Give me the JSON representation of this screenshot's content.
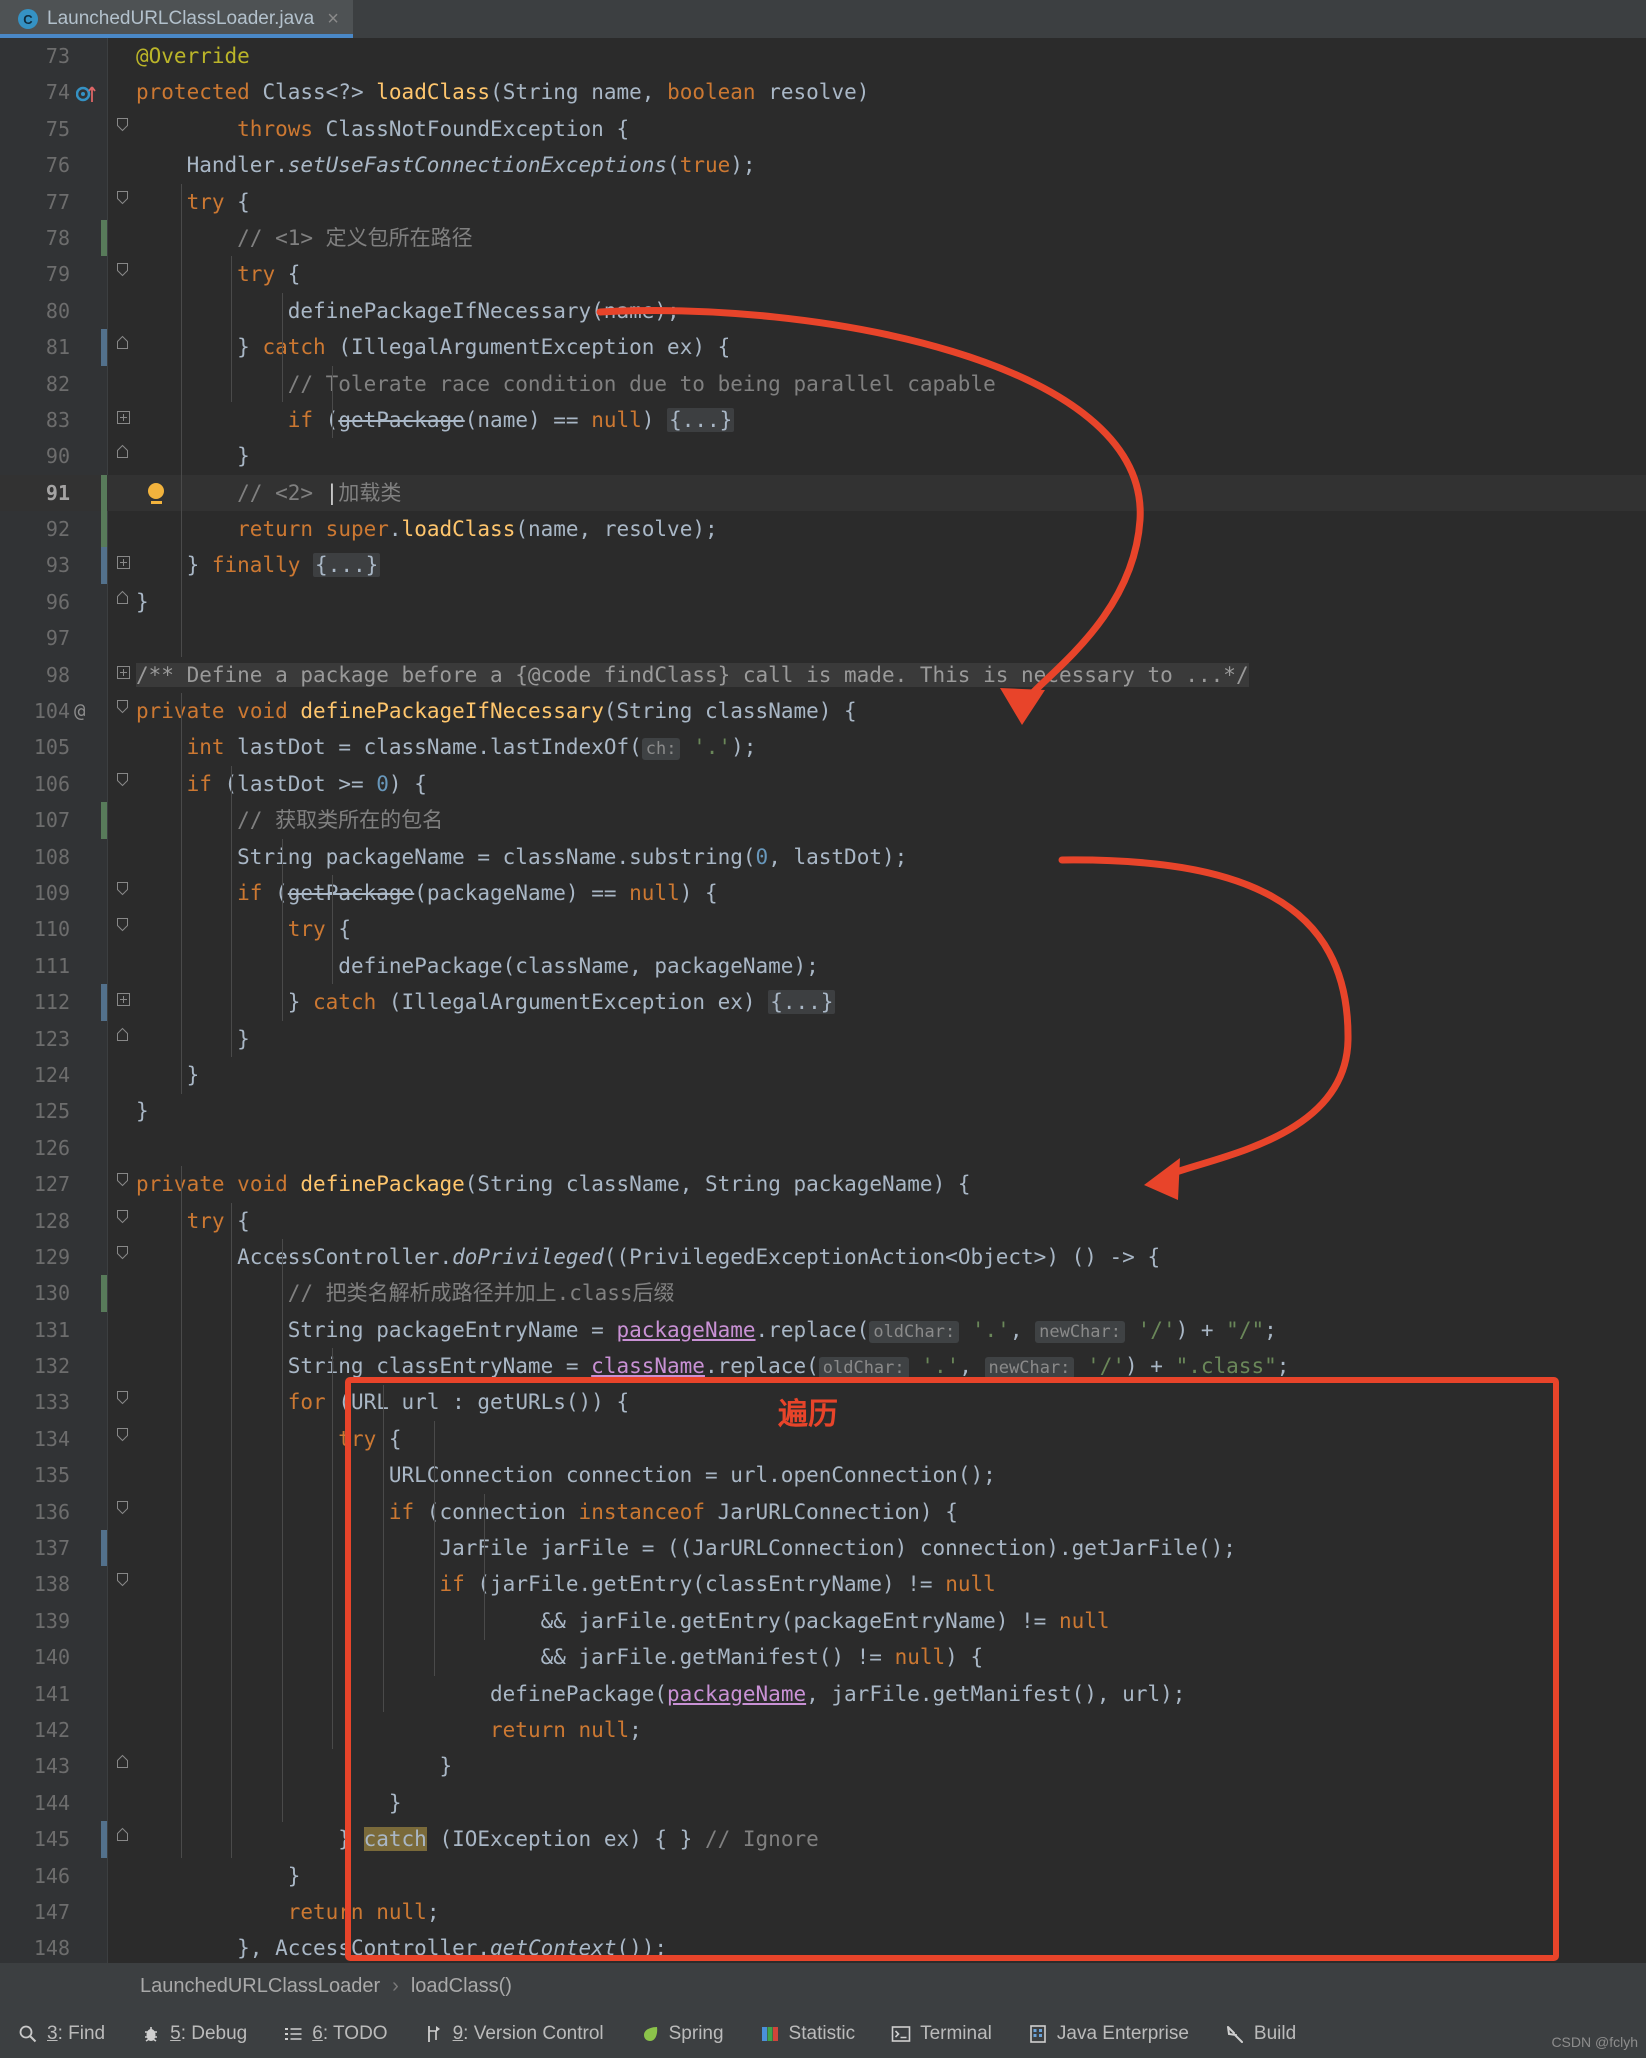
{
  "tab": {
    "icon": "java-class-icon",
    "title": "LaunchedURLClassLoader.java",
    "close": "×"
  },
  "editor": {
    "lines": [
      {
        "num": "73",
        "indent": 0,
        "html": "<span class=\"ann\">@Override</span>"
      },
      {
        "num": "74",
        "indent": 0,
        "html": "<span class=\"kw\">protected</span> <span class=\"txt\">Class&lt;?&gt;</span> <span class=\"mth\">loadClass</span><span class=\"txt\">(String name, </span><span class=\"kw\">boolean</span><span class=\"txt\"> resolve)</span>"
      },
      {
        "num": "75",
        "indent": 0,
        "html": "        <span class=\"kw\">throws</span> <span class=\"txt\">ClassNotFoundException {</span>"
      },
      {
        "num": "76",
        "indent": 0,
        "html": "    <span class=\"txt\">Handler.</span><span class=\"txt ital\">setUseFastConnectionExceptions</span><span class=\"txt\">(</span><span class=\"kw\">true</span><span class=\"txt\">);</span>"
      },
      {
        "num": "77",
        "indent": 0,
        "html": "    <span class=\"kw\">try</span> <span class=\"txt\">{</span>"
      },
      {
        "num": "78",
        "indent": 0,
        "html": "        <span class=\"cmt\">// &lt;1&gt; 定义包所在路径</span>"
      },
      {
        "num": "79",
        "indent": 0,
        "html": "        <span class=\"kw\">try</span> <span class=\"txt\">{</span>"
      },
      {
        "num": "80",
        "indent": 0,
        "html": "            <span class=\"txt\">definePackageIfNecessary(name);</span>"
      },
      {
        "num": "81",
        "indent": 0,
        "html": "        <span class=\"txt\">} </span><span class=\"kw\">catch</span> <span class=\"txt\">(IllegalArgumentException ex) {</span>"
      },
      {
        "num": "82",
        "indent": 0,
        "html": "            <span class=\"cmt\">// Tolerate race condition due to being parallel capable</span>"
      },
      {
        "num": "83",
        "indent": 0,
        "html": "            <span class=\"kw\">if</span> <span class=\"txt\">(</span><span class=\"txt strike\">getPackage</span><span class=\"txt\">(name) == </span><span class=\"kw\">null</span><span class=\"txt\">) </span><span class=\"fold\">{...}</span>"
      },
      {
        "num": "90",
        "indent": 0,
        "html": "        <span class=\"txt\">}</span>"
      },
      {
        "num": "91",
        "indent": 0,
        "current": true,
        "html": "        <span class=\"cmt\">// &lt;2&gt; </span><span class=\"caret\">|</span><span class=\"cmt\">加载类</span>"
      },
      {
        "num": "92",
        "indent": 0,
        "html": "        <span class=\"kw\">return</span> <span class=\"kw\">super</span><span class=\"txt\">.</span><span class=\"mth\">loadClass</span><span class=\"txt\">(name, resolve);</span>"
      },
      {
        "num": "93",
        "indent": 0,
        "html": "    <span class=\"txt\">} </span><span class=\"kw\">finally</span> <span class=\"fold\">{...}</span>"
      },
      {
        "num": "96",
        "indent": 0,
        "html": "<span class=\"txt\">}</span>"
      },
      {
        "num": "97",
        "indent": 0,
        "html": ""
      },
      {
        "num": "98",
        "indent": 0,
        "html": "<span class=\"doc docbg\">/** Define a package before a {@code findClass} call is made. This is necessary to ...*/</span>"
      },
      {
        "num": "104",
        "indent": 0,
        "html": "<span class=\"kw\">private</span> <span class=\"kw\">void</span> <span class=\"mth\">definePackageIfNecessary</span><span class=\"txt\">(String className) {</span>"
      },
      {
        "num": "105",
        "indent": 0,
        "html": "    <span class=\"kw\">int</span> <span class=\"txt\">lastDot = className.lastIndexOf(</span><span class=\"hint\">ch:</span> <span class=\"str\">'.'</span><span class=\"txt\">);</span>"
      },
      {
        "num": "106",
        "indent": 0,
        "html": "    <span class=\"kw\">if</span> <span class=\"txt\">(lastDot &gt;= </span><span class=\"num0\">0</span><span class=\"txt\">) {</span>"
      },
      {
        "num": "107",
        "indent": 0,
        "html": "        <span class=\"cmt\">// 获取类所在的包名</span>"
      },
      {
        "num": "108",
        "indent": 0,
        "html": "        <span class=\"txt\">String packageName = className.substring(</span><span class=\"num0\">0</span><span class=\"txt\">, lastDot);</span>"
      },
      {
        "num": "109",
        "indent": 0,
        "html": "        <span class=\"kw\">if</span> <span class=\"txt\">(</span><span class=\"txt strike\">getPackage</span><span class=\"txt\">(packageName) == </span><span class=\"kw\">null</span><span class=\"txt\">) {</span>"
      },
      {
        "num": "110",
        "indent": 0,
        "html": "            <span class=\"kw\">try</span> <span class=\"txt\">{</span>"
      },
      {
        "num": "111",
        "indent": 0,
        "html": "                <span class=\"txt\">definePackage(className, packageName);</span>"
      },
      {
        "num": "112",
        "indent": 0,
        "html": "            <span class=\"txt\">} </span><span class=\"kw\">catch</span> <span class=\"txt\">(IllegalArgumentException ex) </span><span class=\"fold\">{...}</span>"
      },
      {
        "num": "123",
        "indent": 0,
        "html": "        <span class=\"txt\">}</span>"
      },
      {
        "num": "124",
        "indent": 0,
        "html": "    <span class=\"txt\">}</span>"
      },
      {
        "num": "125",
        "indent": 0,
        "html": "<span class=\"txt\">}</span>"
      },
      {
        "num": "126",
        "indent": 0,
        "html": ""
      },
      {
        "num": "127",
        "indent": 0,
        "html": "<span class=\"kw\">private</span> <span class=\"kw\">void</span> <span class=\"mth\">definePackage</span><span class=\"txt\">(String className, String packageName) {</span>"
      },
      {
        "num": "128",
        "indent": 0,
        "html": "    <span class=\"kw\">try</span> <span class=\"txt\">{</span>"
      },
      {
        "num": "129",
        "indent": 0,
        "html": "        <span class=\"txt\">AccessController.</span><span class=\"txt ital\">doPrivileged</span><span class=\"txt\">((PrivilegedExceptionAction&lt;Object&gt;) () -&gt; {</span>"
      },
      {
        "num": "130",
        "indent": 0,
        "html": "            <span class=\"cmt\">// 把类名解析成路径并加上.class后缀</span>"
      },
      {
        "num": "131",
        "indent": 0,
        "html": "            <span class=\"txt\">String packageEntryName = </span><span class=\"field-u\">packageName</span><span class=\"txt\">.replace(</span><span class=\"hint\">oldChar:</span> <span class=\"str\">'.'</span><span class=\"txt\">, </span><span class=\"hint\">newChar:</span> <span class=\"str\">'/'</span><span class=\"txt\">) + </span><span class=\"str\">\"/\"</span><span class=\"txt\">;</span>"
      },
      {
        "num": "132",
        "indent": 0,
        "html": "            <span class=\"txt\">String classEntryName = </span><span class=\"field-u\">className</span><span class=\"txt\">.replace(</span><span class=\"hint\">oldChar:</span> <span class=\"str\">'.'</span><span class=\"txt\">, </span><span class=\"hint\">newChar:</span> <span class=\"str\">'/'</span><span class=\"txt\">) + </span><span class=\"str\">\".class\"</span><span class=\"txt\">;</span>"
      },
      {
        "num": "133",
        "indent": 0,
        "html": "            <span class=\"kw\">for</span> <span class=\"txt\">(URL url : getURLs()) {</span>"
      },
      {
        "num": "134",
        "indent": 0,
        "html": "                <span class=\"kw\">try</span> <span class=\"txt\">{</span>"
      },
      {
        "num": "135",
        "indent": 0,
        "html": "                    <span class=\"txt\">URLConnection connection = url.openConnection();</span>"
      },
      {
        "num": "136",
        "indent": 0,
        "html": "                    <span class=\"kw\">if</span> <span class=\"txt\">(connection </span><span class=\"kw\">instanceof</span><span class=\"txt\"> JarURLConnection) {</span>"
      },
      {
        "num": "137",
        "indent": 0,
        "html": "                        <span class=\"txt\">JarFile jarFile = ((JarURLConnection) connection).getJarFile();</span>"
      },
      {
        "num": "138",
        "indent": 0,
        "html": "                        <span class=\"kw\">if</span> <span class=\"txt\">(jarFile.getEntry(classEntryName) != </span><span class=\"kw\">null</span>"
      },
      {
        "num": "139",
        "indent": 0,
        "html": "                                <span class=\"txt\">&amp;&amp; jarFile.getEntry(packageEntryName) != </span><span class=\"kw\">null</span>"
      },
      {
        "num": "140",
        "indent": 0,
        "html": "                                <span class=\"txt\">&amp;&amp; jarFile.getManifest() != </span><span class=\"kw\">null</span><span class=\"txt\">) {</span>"
      },
      {
        "num": "141",
        "indent": 0,
        "html": "                            <span class=\"txt\">definePackage(</span><span class=\"field-u\">packageName</span><span class=\"txt\">, jarFile.getManifest(), url);</span>"
      },
      {
        "num": "142",
        "indent": 0,
        "html": "                            <span class=\"kw\">return</span> <span class=\"kw\">null</span><span class=\"txt\">;</span>"
      },
      {
        "num": "143",
        "indent": 0,
        "html": "                        <span class=\"txt\">}</span>"
      },
      {
        "num": "144",
        "indent": 0,
        "html": "                    <span class=\"txt\">}</span>"
      },
      {
        "num": "145",
        "indent": 0,
        "html": "                <span class=\"txt\">} </span><span class=\"hl-catch\">catch</span><span class=\"txt\"> (IOException ex) { } </span><span class=\"cmt\">// Ignore</span>"
      },
      {
        "num": "146",
        "indent": 0,
        "html": "            <span class=\"txt\">}</span>"
      },
      {
        "num": "147",
        "indent": 0,
        "html": "            <span class=\"kw\">return</span> <span class=\"kw\">null</span><span class=\"txt\">;</span>"
      },
      {
        "num": "148",
        "indent": 0,
        "html": "        <span class=\"txt\">}, AccessController.</span><span class=\"txt ital\">getContext</span><span class=\"txt\">());</span>"
      }
    ]
  },
  "annotations": {
    "color": "#e8442a",
    "note_traverse": "遍历"
  },
  "breadcrumb": {
    "class": "LaunchedURLClassLoader",
    "separator": "›",
    "method": "loadClass()"
  },
  "statusbar": {
    "items": [
      {
        "name": "find",
        "icon": "search-icon",
        "key": "3",
        "label": ": Find"
      },
      {
        "name": "debug",
        "icon": "bug-icon",
        "key": "5",
        "label": ": Debug"
      },
      {
        "name": "todo",
        "icon": "list-icon",
        "key": "6",
        "label": ": TODO"
      },
      {
        "name": "version-control",
        "icon": "branch-icon",
        "key": "9",
        "label": ": Version Control"
      },
      {
        "name": "spring",
        "icon": "spring-leaf-icon",
        "key": "",
        "label": "Spring"
      },
      {
        "name": "statistic",
        "icon": "statistic-icon",
        "key": "",
        "label": "Statistic"
      },
      {
        "name": "terminal",
        "icon": "terminal-icon",
        "key": "",
        "label": "Terminal"
      },
      {
        "name": "java-enterprise",
        "icon": "java-enterprise-icon",
        "key": "",
        "label": "Java Enterprise"
      },
      {
        "name": "build",
        "icon": "hammer-icon",
        "key": "",
        "label": "Build"
      }
    ]
  },
  "watermark": "CSDN @fclyh"
}
